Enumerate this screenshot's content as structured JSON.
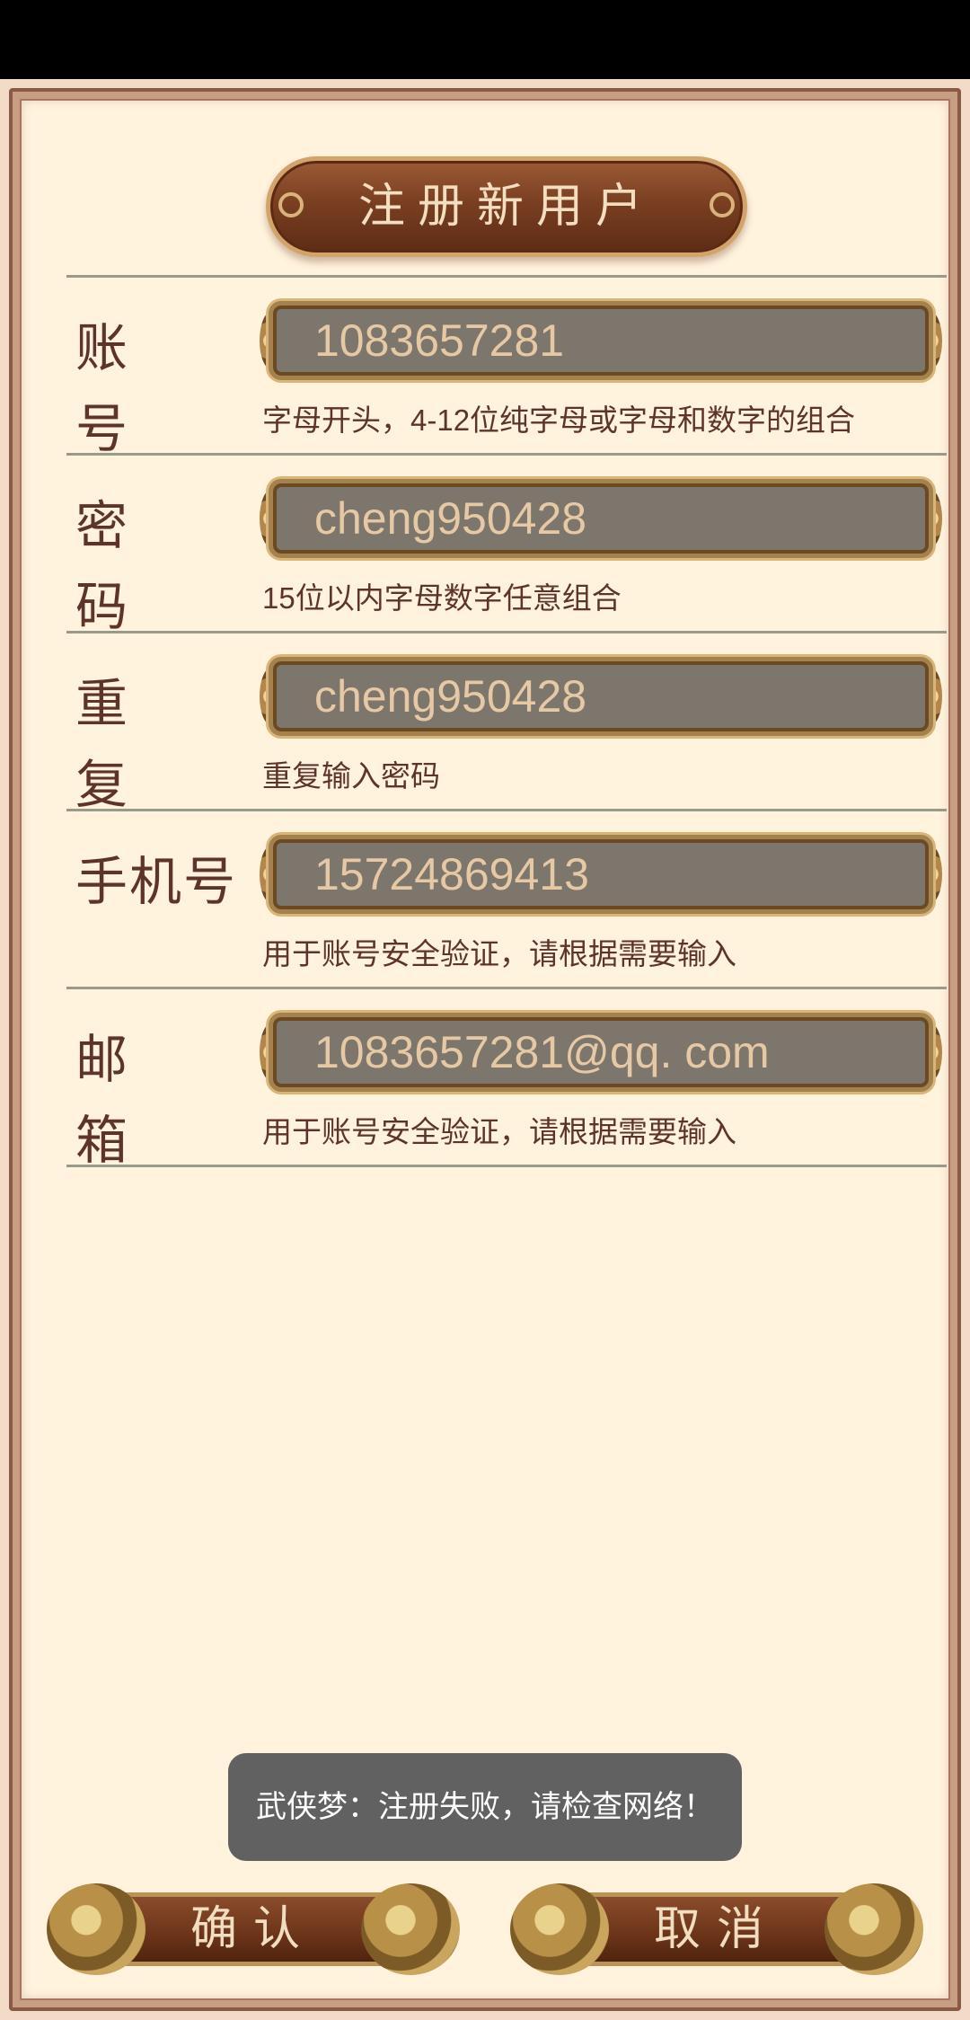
{
  "title": "注册新用户",
  "fields": [
    {
      "label": "账号",
      "value": "1083657281",
      "hint": "字母开头，4-12位纯字母或字母和数字的组合"
    },
    {
      "label": "密码",
      "value": "cheng950428",
      "hint": "15位以内字母数字任意组合"
    },
    {
      "label": "重复",
      "value": "cheng950428",
      "hint": "重复输入密码"
    },
    {
      "label": "手机号",
      "value": "15724869413",
      "hint": "用于账号安全验证，请根据需要输入"
    },
    {
      "label": "邮箱",
      "value": "1083657281@qq. com",
      "hint": "用于账号安全验证，请根据需要输入"
    }
  ],
  "toast": "武侠梦：注册失败，请检查网络！",
  "buttons": {
    "confirm": "确认",
    "cancel": "取消"
  }
}
